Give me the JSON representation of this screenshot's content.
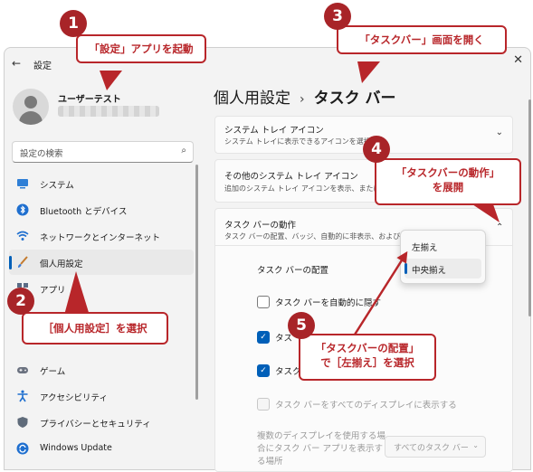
{
  "window": {
    "back_glyph": "←",
    "title": "設定",
    "close_glyph": "✕"
  },
  "user": {
    "name": "ユーザーテスト"
  },
  "search": {
    "placeholder": "設定の検索"
  },
  "sidebar": {
    "items": [
      {
        "label": "システム",
        "icon": "monitor-icon"
      },
      {
        "label": "Bluetooth とデバイス",
        "icon": "bluetooth-icon"
      },
      {
        "label": "ネットワークとインターネット",
        "icon": "wifi-icon"
      },
      {
        "label": "個人用設定",
        "icon": "brush-icon",
        "active": true
      },
      {
        "label": "アプリ",
        "icon": "apps-icon"
      },
      {
        "label": "ゲーム",
        "icon": "gamepad-icon"
      },
      {
        "label": "アクセシビリティ",
        "icon": "accessibility-icon"
      },
      {
        "label": "プライバシーとセキュリティ",
        "icon": "shield-icon"
      },
      {
        "label": "Windows Update",
        "icon": "update-icon"
      }
    ]
  },
  "breadcrumb": {
    "parent": "個人用設定",
    "separator": "›",
    "current": "タスク バー"
  },
  "cards": {
    "tray_icons": {
      "title": "システム トレイ アイコン",
      "subtitle": "システム トレイに表示できるアイコンを選択しま"
    },
    "other_tray_icons": {
      "title": "その他のシステム トレイ アイコン",
      "subtitle": "追加のシステム トレイ アイコンを表示、または非"
    },
    "behaviors": {
      "title": "タスク バーの動作",
      "subtitle": "タスク バーの配置、バッジ、自動的に非表示、および複数"
    }
  },
  "behaviors": {
    "alignment_label": "タスク バーの配置",
    "auto_hide_label": "タスク バーを自動的に隠す",
    "row3_label": "タス",
    "row4_label": "タスク",
    "all_displays_label": "タスク バーをすべてのディスプレイに表示する",
    "multi_display_label_1": "複数のディスプレイを使用する場",
    "multi_display_label_2": "合にタスク バー アプリを表示す",
    "multi_display_label_3": "る場所",
    "multi_display_value": "すべてのタスク バー"
  },
  "alignment_dropdown": {
    "options": [
      "左揃え",
      "中央揃え"
    ],
    "selected": "中央揃え"
  },
  "callouts": {
    "c1": {
      "num": "1",
      "text": "「設定」アプリを起動"
    },
    "c2": {
      "num": "2",
      "text": "［個人用設定］を選択"
    },
    "c3": {
      "num": "3",
      "text": "「タスクバー」画面を開く"
    },
    "c4": {
      "num": "4",
      "line1": "「タスクバーの動作」",
      "line2": "を展開"
    },
    "c5": {
      "num": "5",
      "line1": "「タスクバーの配置」",
      "line2": "で［左揃え］を選択"
    }
  },
  "colors": {
    "callout_red": "#b8262a",
    "accent_blue": "#005fb8"
  }
}
